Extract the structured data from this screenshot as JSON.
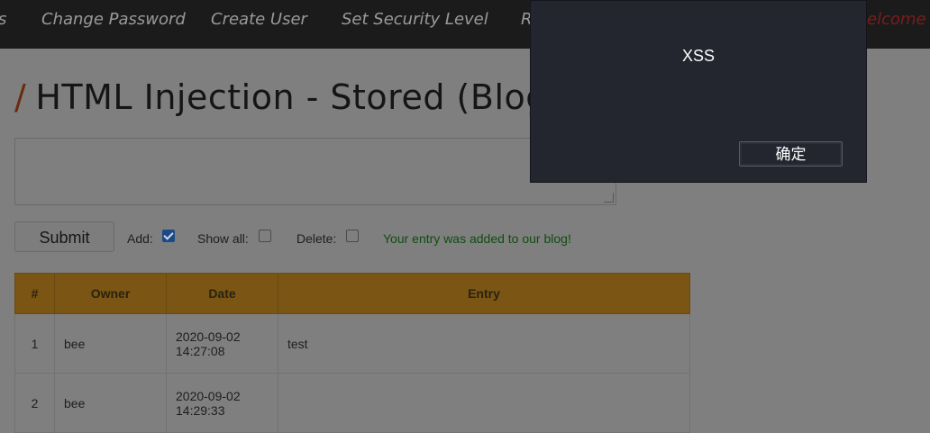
{
  "nav": {
    "items": [
      "s",
      "Change Password",
      "Create User",
      "Set Security Level",
      "R"
    ],
    "welcome": "elcome B"
  },
  "page": {
    "title": "HTML Injection - Stored (Blog)",
    "title_marker": "/"
  },
  "form": {
    "submit_label": "Submit",
    "add_label": "Add:",
    "add_checked": true,
    "show_all_label": "Show all:",
    "show_all_checked": false,
    "delete_label": "Delete:",
    "delete_checked": false,
    "status_message": "Your entry was added to our blog!"
  },
  "table": {
    "headers": [
      "#",
      "Owner",
      "Date",
      "Entry"
    ],
    "rows": [
      {
        "num": "1",
        "owner": "bee",
        "date": "2020-09-02",
        "time": "14:27:08",
        "entry": "test"
      },
      {
        "num": "2",
        "owner": "bee",
        "date": "2020-09-02",
        "time": "14:29:33",
        "entry": ""
      }
    ]
  },
  "dialog": {
    "message": "XSS",
    "ok_label": "确定"
  },
  "colors": {
    "header_accent": "#e8a726",
    "success_text": "#1a9a1a",
    "welcome_text": "#e02020"
  }
}
